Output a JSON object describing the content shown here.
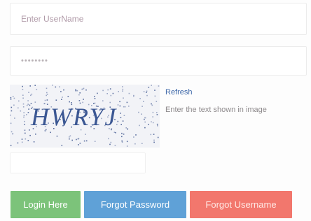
{
  "form": {
    "username_placeholder": "Enter UserName",
    "password_value": "••••••••",
    "captcha_text": "HWRYJ",
    "refresh_label": "Refresh",
    "captcha_hint": "Enter the text shown in image",
    "captcha_input_value": ""
  },
  "buttons": {
    "login": "Login Here",
    "forgot_password": "Forgot Password",
    "forgot_username": "Forgot Username"
  },
  "colors": {
    "login_button": "#7cc37a",
    "forgot_password_button": "#5fa1d7",
    "forgot_username_button": "#f2776d",
    "refresh_link": "#3d67a8",
    "captcha_text": "#3b5793"
  }
}
